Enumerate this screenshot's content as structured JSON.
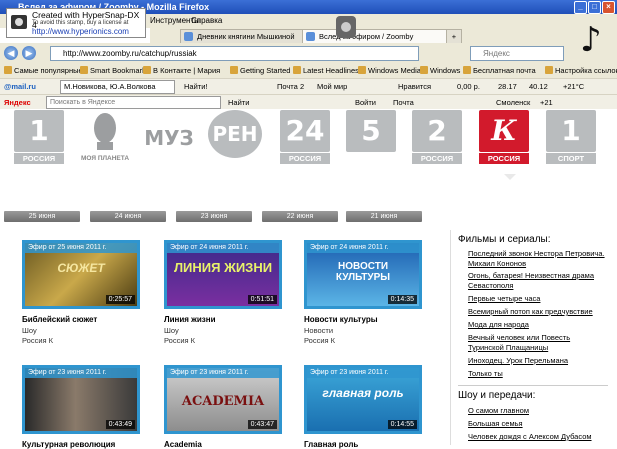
{
  "window": {
    "title": "Вслед за эфиром / Zoomby - Mozilla Firefox",
    "minimize_glyph": "_",
    "maximize_glyph": "□",
    "close_glyph": "×"
  },
  "stamp": {
    "line1": "Created with HyperSnap-DX 4",
    "line2": "To avoid this stamp, buy a license at",
    "line3": "http://www.hyperionics.com"
  },
  "menu": {
    "tools": "Инструменты",
    "help": "Справка"
  },
  "tabs": [
    {
      "label": "Дневник княгини Мышкиной"
    },
    {
      "label": "Вслед за эфиром / Zoomby"
    }
  ],
  "tab_close": "×",
  "tab_new": "+",
  "nav": {
    "url": "http://www.zoomby.ru/catchup/russiak",
    "search_placeholder": "Яндекс",
    "back_glyph": "◀",
    "forward_glyph": "▶"
  },
  "bookmarks": [
    "Самые популярные",
    "Smart Bookmarks",
    "В Контакте | Мария",
    "Getting Started",
    "Latest Headlines",
    "Windows Media",
    "Windows",
    "Бесплатная почта",
    "Настройка ссылок"
  ],
  "mail_toolbar": {
    "brand": "@mail.ru",
    "user": "М.Новикова, Ю.А.Волкова",
    "find": "Найти!",
    "mail": "Почта",
    "mail_count": "2",
    "my_world": "Мой мир",
    "likes": "Нравится",
    "money": "0,00 р.",
    "usd": "28.17",
    "eur": "40.12",
    "temp": "+21°C"
  },
  "yandex_toolbar": {
    "brand": "Яндекс",
    "search_placeholder": "Поискать в Яндексе",
    "find": "Найти",
    "login": "Войти",
    "mail": "Почта",
    "city": "Смоленск",
    "temp": "+21"
  },
  "channels": [
    {
      "logo": "1",
      "label": "РОССИЯ"
    },
    {
      "logo": "",
      "label": "МОЯ ПЛАНЕТА"
    },
    {
      "logo": "МУЗ",
      "label": ""
    },
    {
      "logo": "РЕН",
      "label": ""
    },
    {
      "logo": "24",
      "label": "РОССИЯ"
    },
    {
      "logo": "5",
      "label": ""
    },
    {
      "logo": "2",
      "label": "РОССИЯ"
    },
    {
      "logo": "К",
      "label": "РОССИЯ"
    },
    {
      "logo": "1",
      "label": "СПОРТ"
    }
  ],
  "dates": [
    "25 июня",
    "24 июня",
    "23 июня",
    "22 июня",
    "21 июня"
  ],
  "shows": [
    {
      "air": "Эфир от 25 июня 2011 г.",
      "duration": "0:25:57",
      "name": "Библейский сюжет",
      "genre": "Шоу",
      "channel": "Россия К",
      "art": "СЮЖЕТ"
    },
    {
      "air": "Эфир от 24 июня 2011 г.",
      "duration": "0:51:51",
      "name": "Линия жизни",
      "genre": "Шоу",
      "channel": "Россия К",
      "art": "ЛИНИЯ ЖИЗНИ"
    },
    {
      "air": "Эфир от 24 июня 2011 г.",
      "duration": "0:14:35",
      "name": "Новости культуры",
      "genre": "Новости",
      "channel": "Россия К",
      "art": "НОВОСТИ КУЛЬТУРЫ"
    },
    {
      "air": "Эфир от 23 июня 2011 г.",
      "duration": "0:43:49",
      "name": "Культурная революция",
      "genre": "",
      "channel": "",
      "art": ""
    },
    {
      "air": "Эфир от 23 июня 2011 г.",
      "duration": "0:43:47",
      "name": "Academia",
      "genre": "",
      "channel": "",
      "art": "ACADEMIA"
    },
    {
      "air": "Эфир от 23 июня 2011 г.",
      "duration": "0:14:55",
      "name": "Главная роль",
      "genre": "",
      "channel": "",
      "art": "главная роль"
    }
  ],
  "sidebar": {
    "films_heading": "Фильмы и сериалы:",
    "films": [
      "Последний звонок Нестора Петровича.",
      "Михаил Кононов",
      "Огонь, батарея! Неизвестная драма",
      "Севастополя",
      "Первые четыре часа",
      "Всемирный потоп как предчувствие",
      "Мода для народа",
      "Вечный человек или Повесть",
      "Туринской Плащаницы",
      "Иноходец. Урок Перельмана",
      "Только ты"
    ],
    "shows_heading": "Шоу и передачи:",
    "shows": [
      "О самом главном",
      "Большая семья",
      "Человек дождя с Алексом Дубасом"
    ]
  },
  "colors": {
    "accent_blue": "#2f95cf",
    "kultura_red": "#d21a2c",
    "channel_grey": "#b9bcbe"
  }
}
